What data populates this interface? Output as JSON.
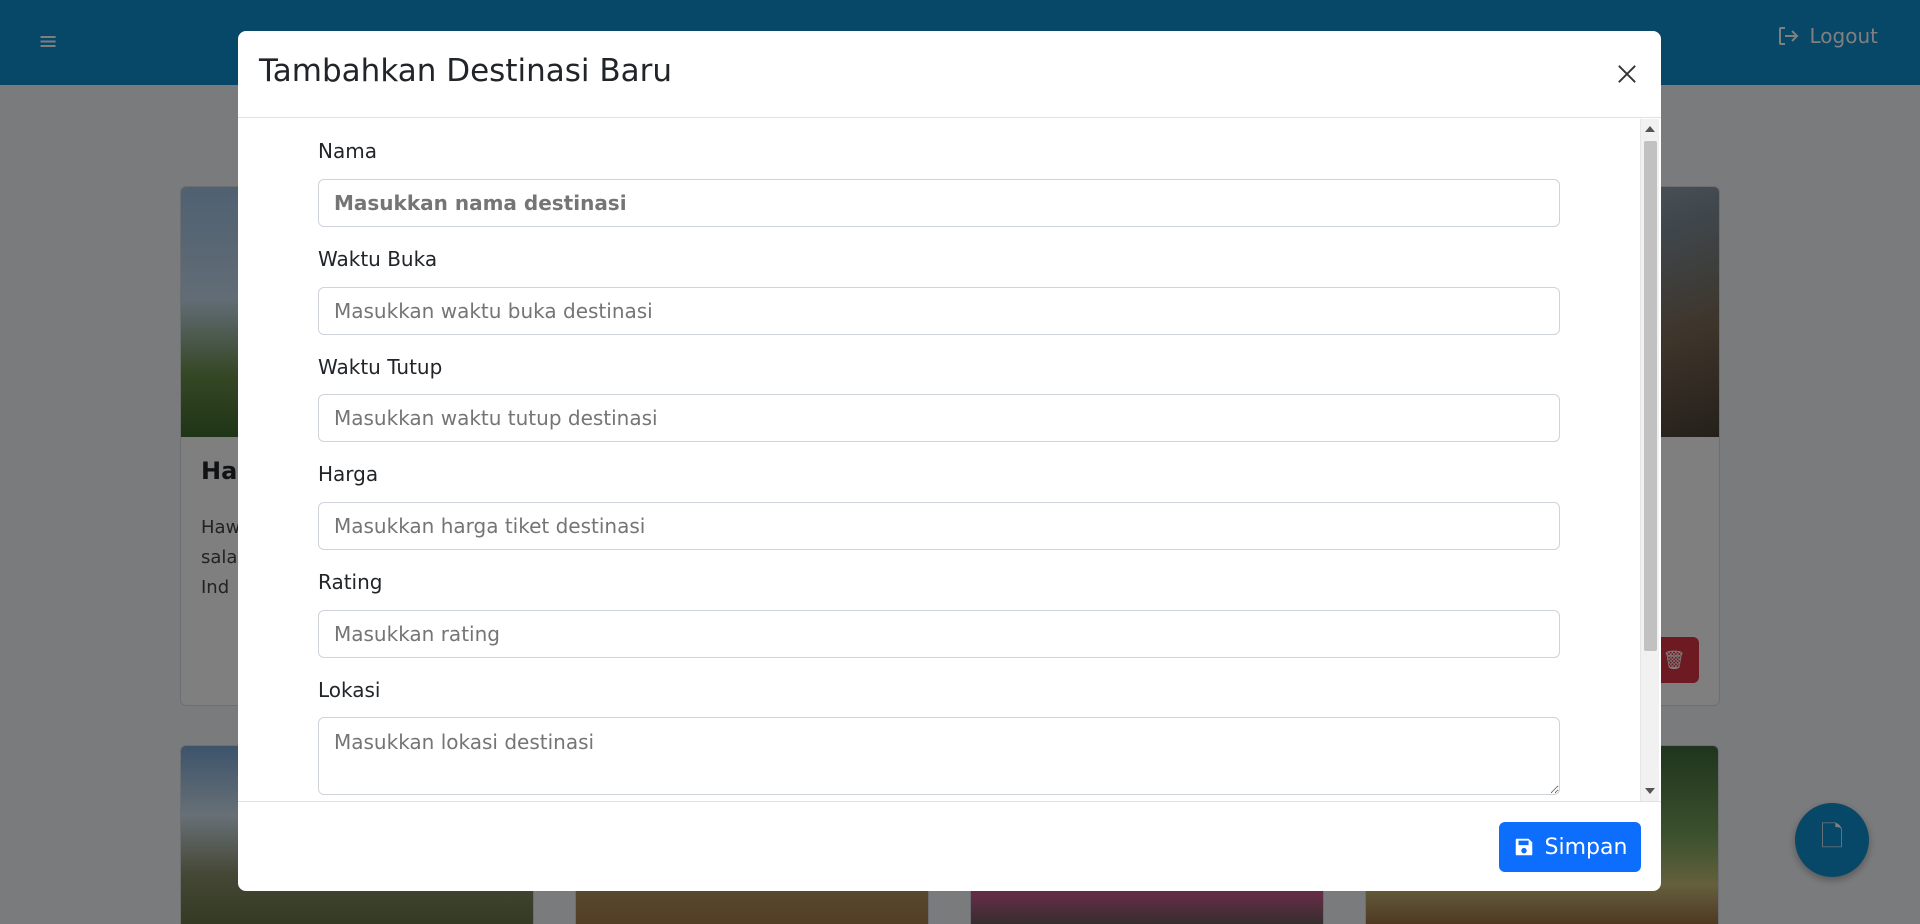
{
  "topbar": {
    "logout_label": "Logout"
  },
  "background_cards": [
    {
      "title": "Ha",
      "desc": "Haw\nsala\nInd"
    }
  ],
  "modal": {
    "title": "Tambahkan Destinasi Baru",
    "fields": [
      {
        "label": "Nama",
        "placeholder": "Masukkan nama destinasi"
      },
      {
        "label": "Waktu Buka",
        "placeholder": "Masukkan waktu buka destinasi"
      },
      {
        "label": "Waktu Tutup",
        "placeholder": "Masukkan waktu tutup destinasi"
      },
      {
        "label": "Harga",
        "placeholder": "Masukkan harga tiket destinasi"
      },
      {
        "label": "Rating",
        "placeholder": "Masukkan rating"
      },
      {
        "label": "Lokasi",
        "placeholder": "Masukkan lokasi destinasi"
      }
    ],
    "save_label": "Simpan"
  },
  "colors": {
    "topbar": "#0f8fd0",
    "primary": "#0d6efd",
    "danger": "#dc3545"
  }
}
